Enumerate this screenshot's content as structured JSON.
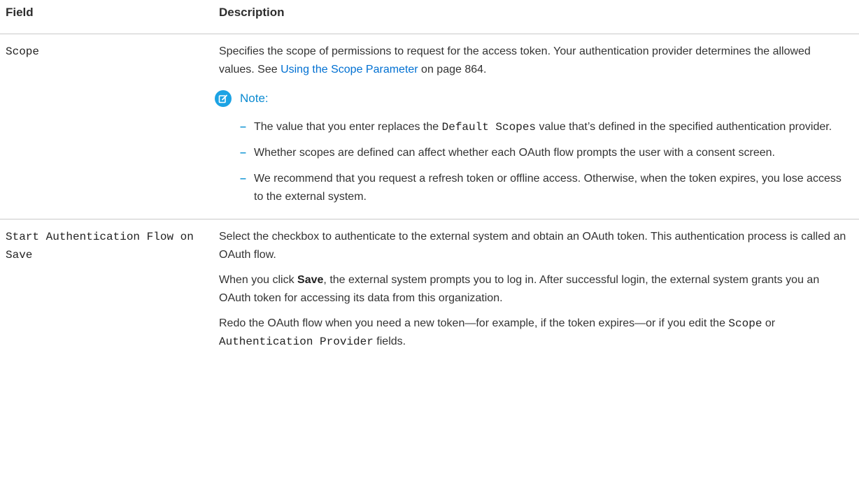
{
  "header": {
    "field": "Field",
    "description": "Description"
  },
  "scope_row": {
    "field_name": "Scope",
    "desc_before_link": "Specifies the scope of permissions to request for the access token. Your authentication provider determines the allowed values. See ",
    "link_text": "Using the Scope Parameter",
    "desc_after_link": " on page 864.",
    "note": {
      "label": "Note:",
      "icon": "edit-pencil-icon",
      "items": [
        {
          "before": "The value that you enter replaces the ",
          "code": "Default Scopes",
          "after": " value that’s defined in the specified authentication provider."
        },
        {
          "before": "Whether scopes are defined can affect whether each OAuth flow prompts the user with a consent screen.",
          "code": "",
          "after": ""
        },
        {
          "before": "We recommend that you request a refresh token or offline access. Otherwise, when the token expires, you lose access to the external system.",
          "code": "",
          "after": ""
        }
      ]
    }
  },
  "auth_row": {
    "field_name": "Start Authentication Flow on Save",
    "p1": "Select the checkbox to authenticate to the external system and obtain an OAuth token. This authentication process is called an OAuth flow.",
    "p2_before": "When you click ",
    "p2_bold": "Save",
    "p2_after": ", the external system prompts you to log in. After successful login, the external system grants you an OAuth token for accessing its data from this organization.",
    "p3_before": "Redo the OAuth flow when you need a new token—for example, if the token expires—or if you edit the ",
    "p3_code1": "Scope",
    "p3_mid": " or ",
    "p3_code2": "Authentication Provider",
    "p3_after": " fields."
  },
  "colors": {
    "link": "#0070d2",
    "note_icon": "#1ca3e4",
    "note_label": "#0b8ad1",
    "border": "#c9c9c9"
  }
}
